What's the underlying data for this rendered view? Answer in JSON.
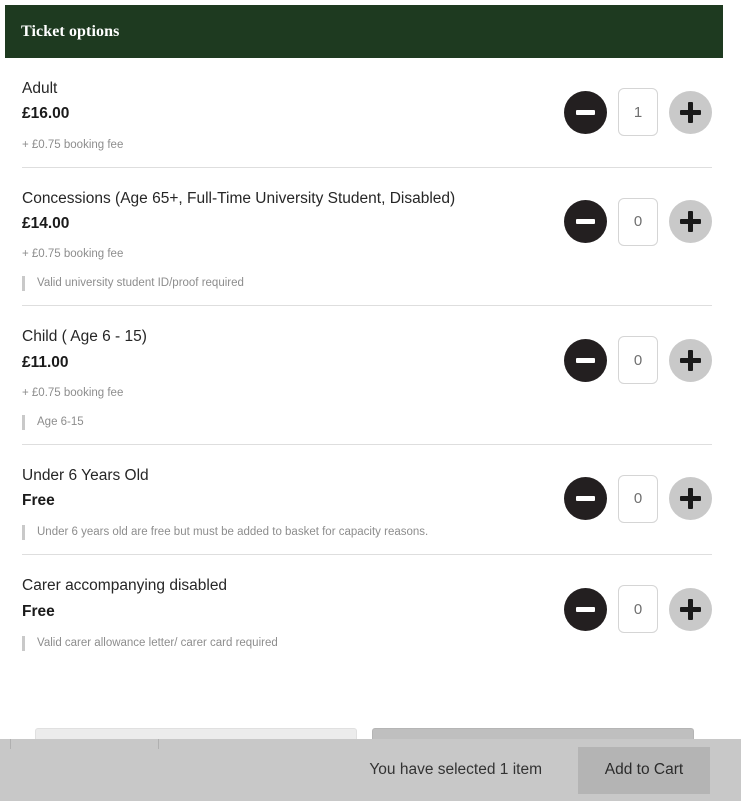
{
  "panel": {
    "header_title": "Ticket options"
  },
  "colors": {
    "header_green": "#1e3a20",
    "minus_button": "#231f20",
    "plus_button": "#c9c9c9",
    "footer_bar": "#c8c8c8",
    "add_to_cart_button": "#b4b4b4",
    "divider": "#dedede",
    "muted_text": "#8d8d8d"
  },
  "tickets": [
    {
      "name": "Adult",
      "price": "£16.00",
      "booking_fee": "+ £0.75 booking fee",
      "note": "",
      "quantity": "1",
      "minus_icon": "minus-icon",
      "plus_icon": "plus-icon"
    },
    {
      "name": "Concessions (Age 65+, Full-Time University Student, Disabled)",
      "price": "£14.00",
      "booking_fee": "+ £0.75 booking fee",
      "note": "Valid university student ID/proof required",
      "quantity": "0",
      "minus_icon": "minus-icon",
      "plus_icon": "plus-icon"
    },
    {
      "name": "Child ( Age 6 - 15)",
      "price": "£11.00",
      "booking_fee": "+ £0.75 booking fee",
      "note": "Age 6-15",
      "quantity": "0",
      "minus_icon": "minus-icon",
      "plus_icon": "plus-icon"
    },
    {
      "name": "Under 6 Years Old",
      "price": "Free",
      "booking_fee": "",
      "note": "Under 6 years old are free but must be added to basket for capacity reasons.",
      "quantity": "0",
      "minus_icon": "minus-icon",
      "plus_icon": "plus-icon"
    },
    {
      "name": "Carer accompanying disabled",
      "price": "Free",
      "booking_fee": "",
      "note": "Valid carer allowance letter/ carer card required",
      "quantity": "0",
      "minus_icon": "minus-icon",
      "plus_icon": "plus-icon"
    }
  ],
  "footer": {
    "selection_text": "You have selected 1 item",
    "add_to_cart_label": "Add to Cart"
  }
}
